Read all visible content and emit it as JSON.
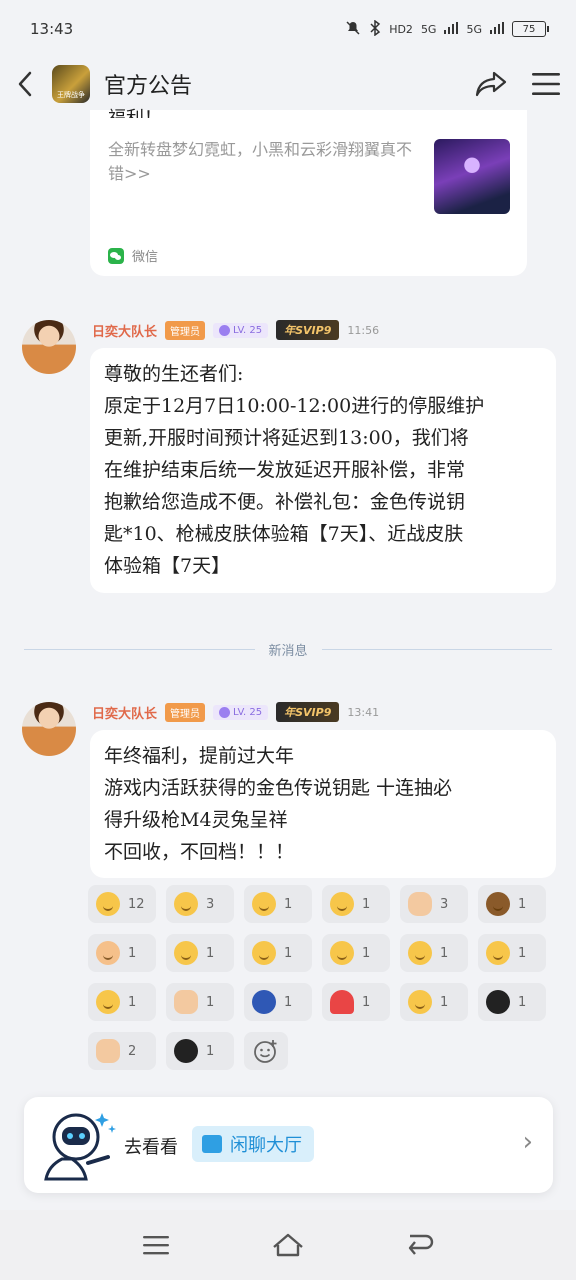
{
  "status_bar": {
    "time": "13:43",
    "network_labels": [
      "5G",
      "5G"
    ],
    "hd_label": "HD2",
    "battery": "75"
  },
  "header": {
    "app_logo_text": "王牌战争",
    "title": "官方公告"
  },
  "prev_card": {
    "cut_text": "福利！",
    "description": "全新转盘梦幻霓虹，小黑和云彩滑翔翼真不错>>",
    "source": "微信"
  },
  "messages": [
    {
      "sender": "日奕大队长",
      "role": "管理员",
      "level": "LV. 25",
      "vip": "年SVIP9",
      "time": "11:56",
      "lines": [
        "尊敬的生还者们:",
        "原定于12月7日10:00-12:00进行的停服维护",
        "更新,开服时间预计将延迟到13:00，我们将",
        "在维护结束后统一发放延迟开服补偿，非常",
        "抱歉给您造成不便。补偿礼包：金色传说钥",
        "匙*10、枪械皮肤体验箱【7天】、近战皮肤",
        "体验箱【7天】"
      ]
    },
    {
      "sender": "日奕大队长",
      "role": "管理员",
      "level": "LV. 25",
      "vip": "年SVIP9",
      "time": "13:41",
      "lines": [
        "年终福利，提前过大年",
        "游戏内活跃获得的金色传说钥匙 十连抽必",
        "得升级枪M4灵兔呈祥",
        "不回收，不回档！！！"
      ]
    }
  ],
  "divider_text": "新消息",
  "reactions": [
    {
      "icon": "salute-face-icon",
      "count": "12"
    },
    {
      "icon": "peek-face-icon",
      "count": "3"
    },
    {
      "icon": "grin-face-icon",
      "count": "1"
    },
    {
      "icon": "smile-face-icon",
      "count": "1"
    },
    {
      "icon": "thumbs-up-icon",
      "count": "3"
    },
    {
      "icon": "bear-icon",
      "count": "1"
    },
    {
      "icon": "cat-face-icon",
      "count": "1"
    },
    {
      "icon": "headband-face-icon",
      "count": "1"
    },
    {
      "icon": "hug-face-icon",
      "count": "1"
    },
    {
      "icon": "party-face-icon",
      "count": "1"
    },
    {
      "icon": "question-face-icon",
      "count": "1"
    },
    {
      "icon": "thinking-face-icon",
      "count": "1"
    },
    {
      "icon": "sun-icon",
      "count": "1"
    },
    {
      "icon": "handshake-icon",
      "count": "1"
    },
    {
      "icon": "moon-icon",
      "count": "1"
    },
    {
      "icon": "watermelon-icon",
      "count": "1"
    },
    {
      "icon": "sweat-face-icon",
      "count": "1"
    },
    {
      "icon": "penguin-flag-icon",
      "count": "1"
    },
    {
      "icon": "victory-hand-icon",
      "count": "2"
    },
    {
      "icon": "penguin-icon",
      "count": "1"
    }
  ],
  "promo": {
    "go_label": "去看看",
    "chip_label": "闲聊大厅"
  },
  "colors": {
    "accent_blue": "#1f8fd6",
    "sender_orange": "#e0694a",
    "role_badge": "#f19a4a"
  }
}
